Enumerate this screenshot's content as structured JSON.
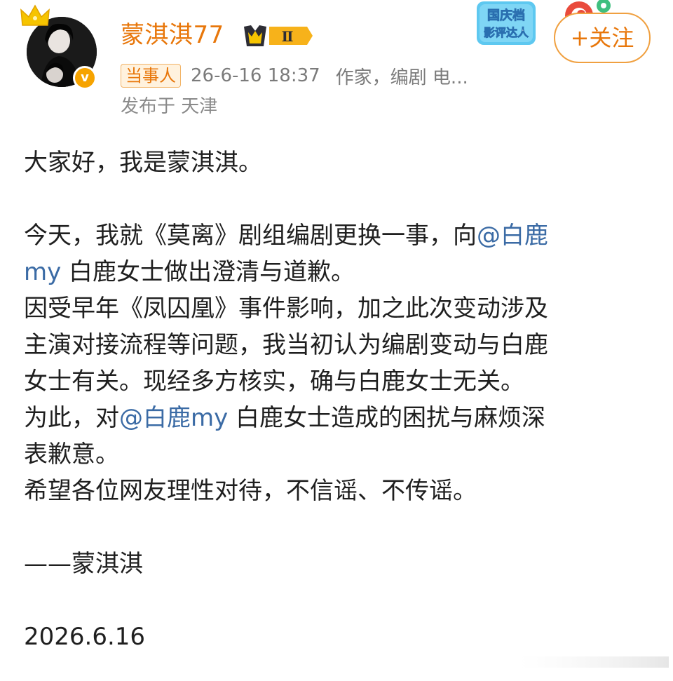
{
  "user": {
    "name": "蒙淇淇77",
    "verified_mark": "v",
    "level_badge": "Ⅱ"
  },
  "promo_badge": {
    "line1": "国庆档",
    "line2": "影评达人"
  },
  "follow_button": {
    "label": "+关注"
  },
  "meta": {
    "tag": "当事人",
    "timestamp": "26-6-16 18:37",
    "role": "作家，编剧 电...",
    "location": "发布于 天津"
  },
  "post": {
    "greeting": "大家好，我是蒙淇淇。",
    "p2_a": "今天，我就《莫离》剧组编剧更换一事，向",
    "mention1": "@白鹿my",
    "p2_b": " 白鹿女士做出澄清与道歉。",
    "p3_line1": "因受早年《凤囚凰》事件影响，加之此次变动涉及",
    "p3_line2": "主演对接流程等问题，我当初认为编剧变动与白鹿",
    "p3_line3": "女士有关。现经多方核实，确与白鹿女士无关。",
    "p4_a": "为此，对",
    "mention2": "@白鹿my",
    "p4_b": " 白鹿女士造成的困扰与麻烦深",
    "p4_line2": "表歉意。",
    "p5": "希望各位网友理性对待，不信谣、不传谣。",
    "signature": "——蒙淇淇",
    "date": "2026.6.16"
  },
  "colors": {
    "username": "#e8770b",
    "mention": "#3b6ba5",
    "meta": "#7b7b7b",
    "badge": "#f6a300"
  },
  "icons": [
    "crown-icon",
    "verified-icon",
    "level-badge-icon",
    "promo-badge-icon"
  ]
}
